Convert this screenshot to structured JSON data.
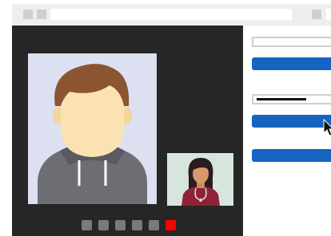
{
  "browser": {
    "toolbar_icons": [
      "toolbar-square-icon",
      "toolbar-square-icon",
      "toolbar-square-icon"
    ],
    "colors": {
      "chrome": "#eeeeee",
      "address_bar": "#ffffff"
    }
  },
  "video_call": {
    "colors": {
      "panel": "#262626",
      "remote_bg": "#dde0f1",
      "self_bg": "#d7e6dc"
    },
    "control_icons": [
      "control-icon",
      "control-icon",
      "control-icon",
      "control-icon",
      "control-icon",
      "end-call-icon"
    ],
    "control_colors": [
      "#7a7a7a",
      "#7a7a7a",
      "#7a7a7a",
      "#7a7a7a",
      "#7a7a7a",
      "#ff0000"
    ]
  },
  "form": {
    "colors": {
      "accent": "#1565c0",
      "field_border": "#cfcfcf"
    },
    "icons": [
      "mouse-pointer-icon"
    ]
  }
}
